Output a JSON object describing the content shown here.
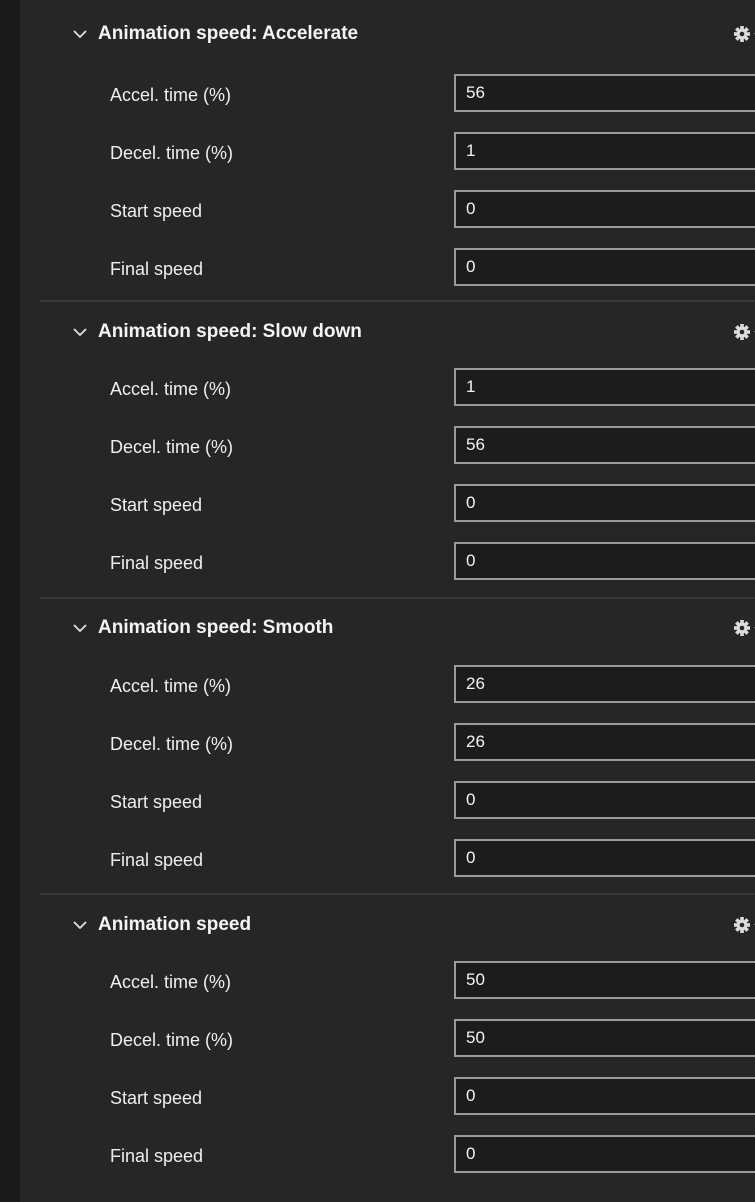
{
  "sections": [
    {
      "title": "Animation speed: Accelerate",
      "fields": [
        {
          "label": "Accel. time (%)",
          "value": "56"
        },
        {
          "label": "Decel. time (%)",
          "value": "1"
        },
        {
          "label": "Start speed",
          "value": "0"
        },
        {
          "label": "Final speed",
          "value": "0"
        }
      ]
    },
    {
      "title": "Animation speed: Slow down",
      "fields": [
        {
          "label": "Accel. time (%)",
          "value": "1"
        },
        {
          "label": "Decel. time (%)",
          "value": "56"
        },
        {
          "label": "Start speed",
          "value": "0"
        },
        {
          "label": "Final speed",
          "value": "0"
        }
      ]
    },
    {
      "title": "Animation speed: Smooth",
      "fields": [
        {
          "label": "Accel. time (%)",
          "value": "26"
        },
        {
          "label": "Decel. time (%)",
          "value": "26"
        },
        {
          "label": "Start speed",
          "value": "0"
        },
        {
          "label": "Final speed",
          "value": "0"
        }
      ]
    },
    {
      "title": "Animation speed",
      "fields": [
        {
          "label": "Accel. time (%)",
          "value": "50"
        },
        {
          "label": "Decel. time (%)",
          "value": "50"
        },
        {
          "label": "Start speed",
          "value": "0"
        },
        {
          "label": "Final speed",
          "value": "0"
        }
      ]
    }
  ],
  "icons": {
    "collapse": "chevron-down-icon",
    "settings": "gear-dropdown-icon"
  },
  "colors": {
    "panel_background": "#262626",
    "input_background": "#1c1c1c",
    "input_border": "#9a9a9a",
    "text": "#f2f2f2"
  }
}
